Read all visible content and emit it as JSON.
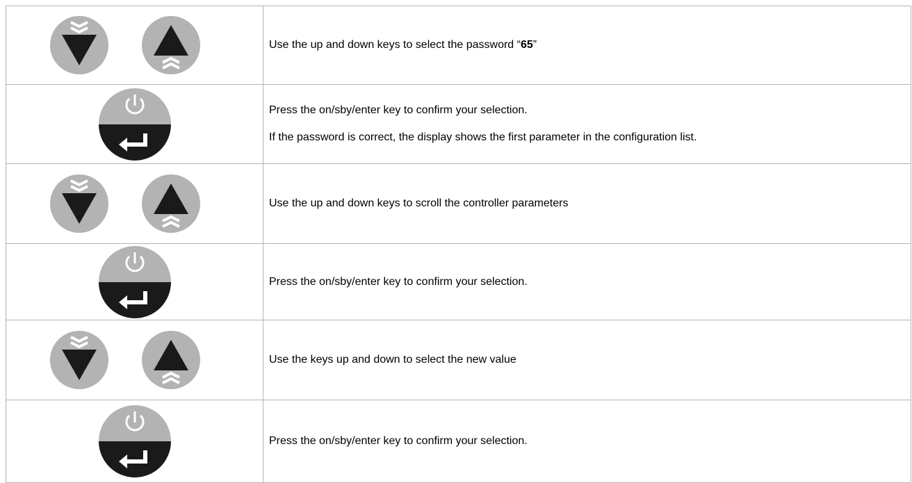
{
  "steps": [
    {
      "keys": [
        "down-key-icon",
        "up-key-icon"
      ],
      "text_pre": "Use the up and down keys to select the password “",
      "text_bold": "65",
      "text_post": "”"
    },
    {
      "keys": [
        "enter-key-icon"
      ],
      "lines": [
        "Press the on/sby/enter key to confirm your selection.",
        "If the password is correct, the display shows the first parameter in the configuration list."
      ]
    },
    {
      "keys": [
        "down-key-icon",
        "up-key-icon"
      ],
      "lines": [
        "Use the up and down keys to scroll the controller parameters"
      ]
    },
    {
      "keys": [
        "enter-key-icon"
      ],
      "lines": [
        "Press the on/sby/enter key to confirm your selection."
      ]
    },
    {
      "keys": [
        "down-key-icon",
        "up-key-icon"
      ],
      "lines": [
        "Use the keys up and down to select the new value"
      ]
    },
    {
      "keys": [
        "enter-key-icon"
      ],
      "lines": [
        "Press the on/sby/enter key to confirm your selection."
      ]
    }
  ],
  "colors": {
    "key_grey": "#b3b3b3",
    "key_dark": "#1a1a1a",
    "border": "#b3b3b3"
  }
}
